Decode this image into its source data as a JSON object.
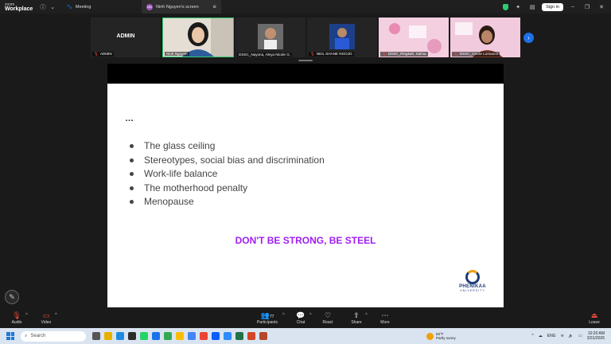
{
  "window": {
    "brand_line1": "zoom",
    "brand_line2": "Workplace",
    "tab_meeting": "Meeting",
    "tab_screen": "Ninh Nguyen's screen",
    "tab_screen_avatar": "NN",
    "signin": "Sign in"
  },
  "participants": [
    {
      "name": "ADMIN",
      "center_label": "ADMIN",
      "muted": true
    },
    {
      "name": "Ninh Nguyen",
      "muted": false,
      "active": true
    },
    {
      "name": "DSSC_Nayona, Aleya Nicole G.",
      "muted": false
    },
    {
      "name": "NEIL SHANE NGOJO",
      "muted": true
    },
    {
      "name": "DSSC_Ringkah, Salma",
      "muted": true
    },
    {
      "name": "DSSC_Cecile Lomanco",
      "muted": true
    }
  ],
  "slide": {
    "heading": "…",
    "bullets": [
      "The glass ceiling",
      "Stereotypes, social bias and discrimination",
      "Work-life balance",
      "The motherhood penalty",
      "Menopause"
    ],
    "tagline": "DON'T BE STRONG, BE STEEL",
    "logo_name": "PHENIKAA",
    "logo_sub": "UNIVERSITY"
  },
  "toolbar": {
    "audio": "Audio",
    "video": "Video",
    "participants": "Participants",
    "participants_count": "77",
    "chat": "Chat",
    "react": "React",
    "share": "Share",
    "more": "More",
    "leave": "Leave"
  },
  "taskbar": {
    "search_placeholder": "Search",
    "weather_temp": "83°F",
    "weather_desc": "Partly sunny",
    "lang": "ENG",
    "time": "10:20 AM",
    "date": "3/31/2026"
  },
  "colors": {
    "accent_green": "#2ecc71",
    "tagline_purple": "#a020f0",
    "muted_red": "#e74c3c"
  }
}
